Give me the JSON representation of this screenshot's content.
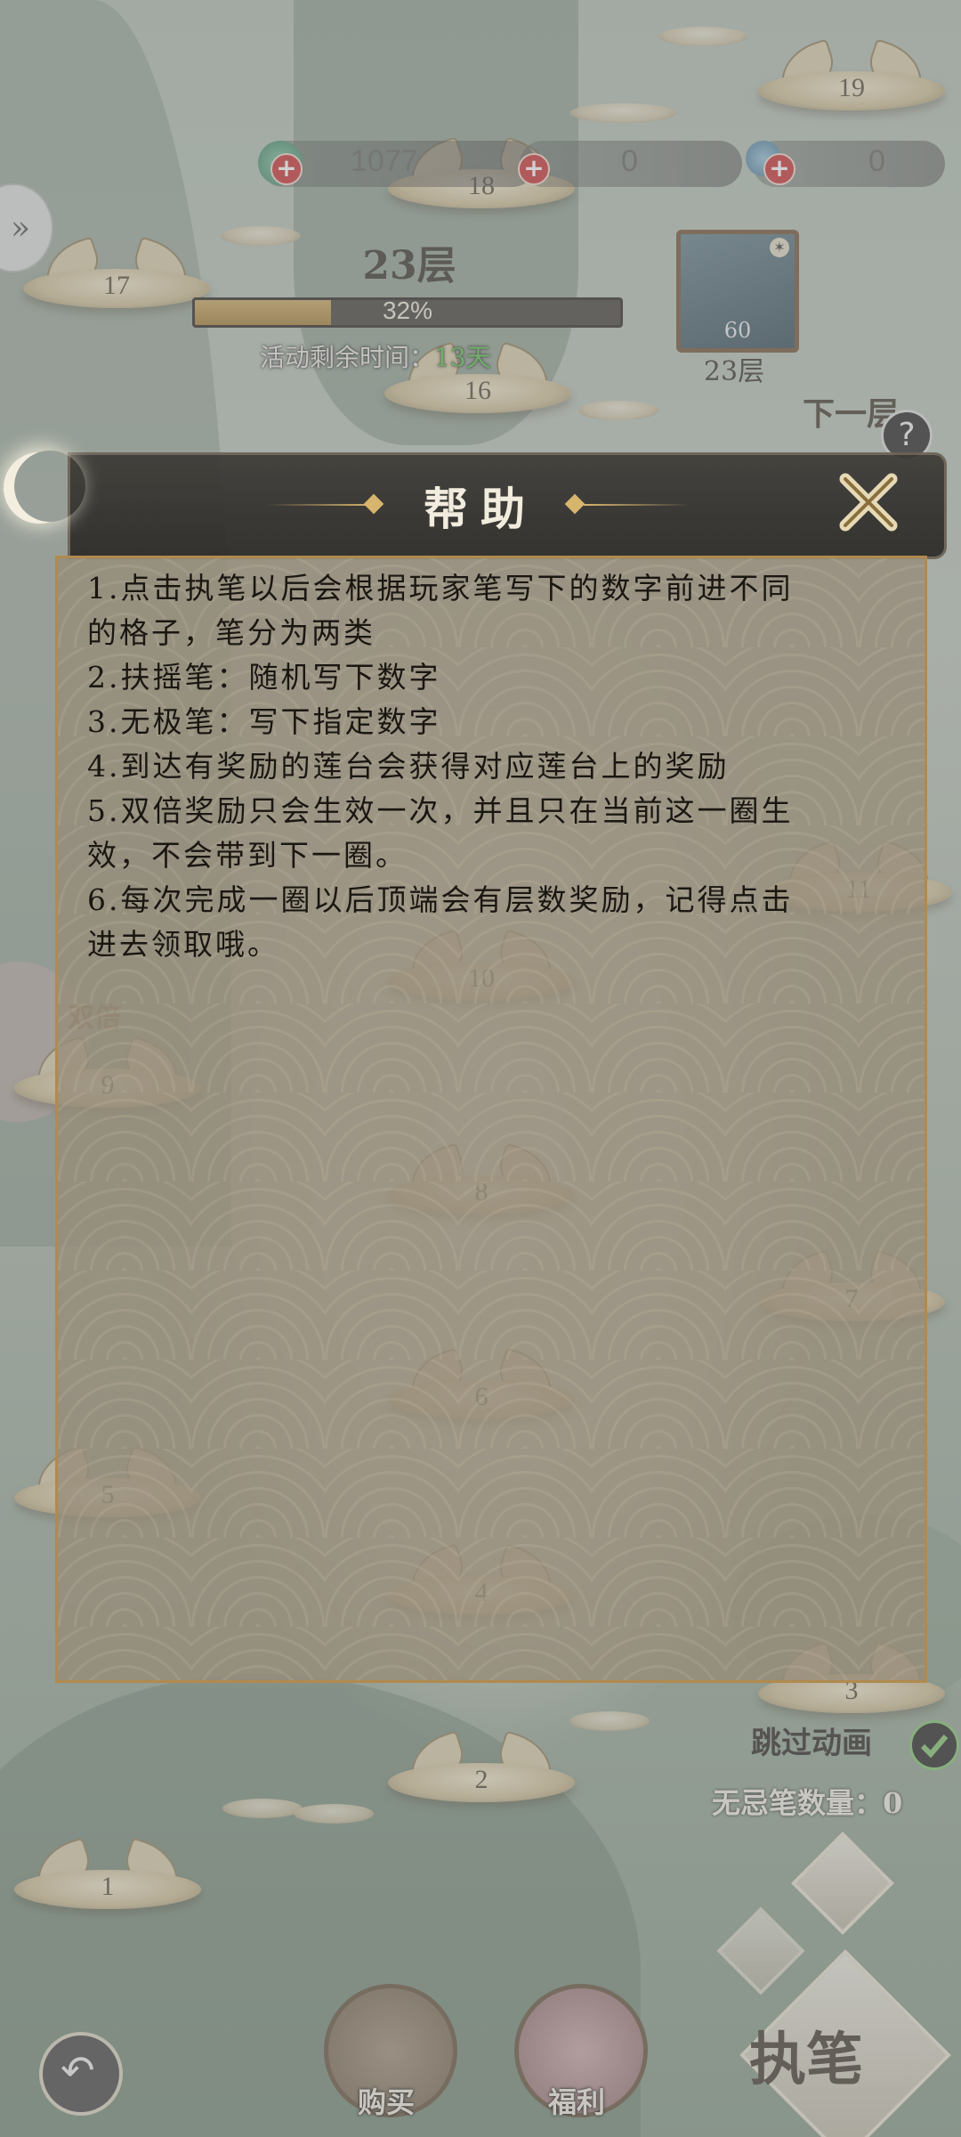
{
  "resources": [
    {
      "name": "jade-currency",
      "value": "1077"
    },
    {
      "name": "ink-currency",
      "value": "0"
    },
    {
      "name": "brush-currency",
      "value": "0"
    }
  ],
  "floor": {
    "current": "23层",
    "progress_text": "32%",
    "progress": 0.32,
    "time_label": "活动剩余时间：",
    "time_days": "13天",
    "boss_level": "60",
    "boss_floor": "23层",
    "next_floor_label": "下一层"
  },
  "board_tiles": [
    "19",
    "18",
    "17",
    "16",
    "11",
    "10",
    "9",
    "8",
    "7",
    "6",
    "5",
    "4",
    "3",
    "2",
    "1"
  ],
  "double_label": "双倍",
  "dialog": {
    "title": "帮助",
    "lines": [
      "1.点击执笔以后会根据玩家笔写下的数字前进不同",
      "的格子，笔分为两类",
      "2.扶摇笔：随机写下数字",
      "3.无极笔：写下指定数字",
      "4.到达有奖励的莲台会获得对应莲台上的奖励",
      "5.双倍奖励只会生效一次，并且只在当前这一圈生",
      "效，不会带到下一圈。",
      "6.每次完成一圈以后顶端会有层数奖励，记得点击",
      "进去领取哦。"
    ]
  },
  "bottom": {
    "skip_animation": "跳过动画",
    "pen_count": "无忌笔数量：0",
    "write_button": "执笔",
    "buy_button": "购买",
    "welfare_button": "福利"
  }
}
